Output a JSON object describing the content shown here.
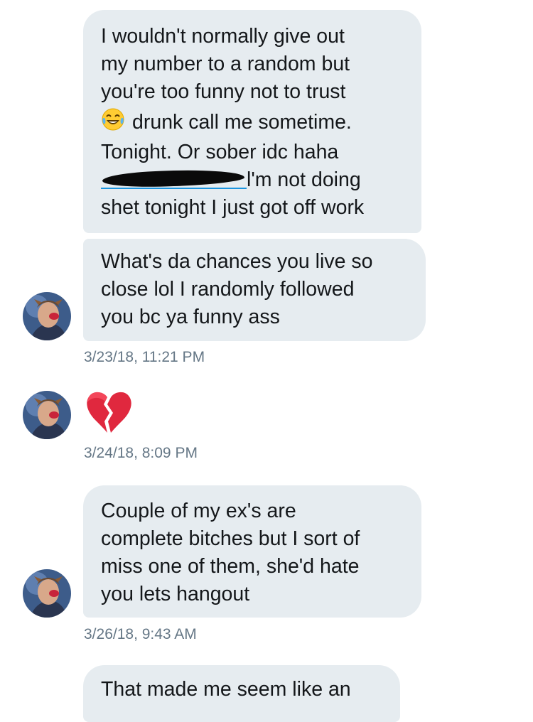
{
  "messages": [
    {
      "lines": [
        "I wouldn't normally give out",
        "my number to a random but",
        "you're too funny not to trust",
        "drunk call me sometime.",
        "Tonight. Or sober idc haha",
        "l'm not doing",
        "shet tonight I just got off work"
      ],
      "emoji": "face-with-tears-of-joy-icon",
      "phone_redacted": true
    },
    {
      "lines": [
        "What's da chances you live so",
        "close lol I randomly followed",
        "you bc ya funny ass"
      ]
    },
    {
      "emoji": "broken-heart-icon"
    },
    {
      "lines": [
        "Couple of my ex's are",
        "complete bitches but I sort of",
        "miss one of them, she'd hate",
        "you lets hangout"
      ]
    },
    {
      "lines": [
        "That made me seem like an"
      ]
    }
  ],
  "timestamps": [
    "3/23/18, 11:21 PM",
    "3/24/18, 8:09 PM",
    "3/26/18, 9:43 AM"
  ],
  "colors": {
    "bubble": "#e6ecf0",
    "text": "#14171a",
    "timestamp": "#657786",
    "link": "#1b95e0"
  }
}
